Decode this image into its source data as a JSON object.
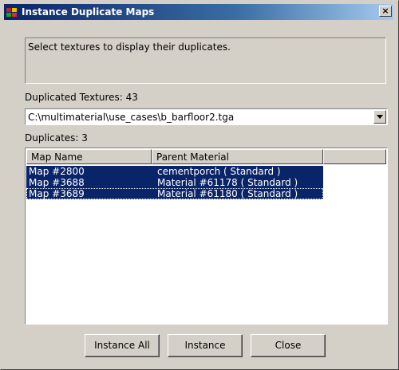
{
  "window": {
    "title": "Instance Duplicate Maps",
    "close_label": "×"
  },
  "prompt": "Select textures to display their duplicates.",
  "duplicated_textures_label": "Duplicated Textures: 43",
  "texture_combo": {
    "selected": "C:\\multimaterial\\use_cases\\b_barfloor2.tga"
  },
  "duplicates_label": "Duplicates: 3",
  "list": {
    "columns": [
      "Map Name",
      "Parent Material"
    ],
    "rows": [
      {
        "map": "Map #2800",
        "parent": "cementporch  ( Standard )",
        "selected": true
      },
      {
        "map": "Map #3688",
        "parent": "Material #61178  ( Standard )",
        "selected": true
      },
      {
        "map": "Map #3689",
        "parent": "Material #61180  ( Standard )",
        "selected": true
      }
    ]
  },
  "buttons": {
    "instance_all": "Instance All",
    "instance": "Instance",
    "close": "Close"
  },
  "colors": {
    "selection": "#0a246a",
    "face": "#d4d0c8",
    "title_start": "#0a246a"
  },
  "icons": {
    "app": "app-icon",
    "close": "close-icon",
    "dropdown": "chevron-down-icon"
  }
}
